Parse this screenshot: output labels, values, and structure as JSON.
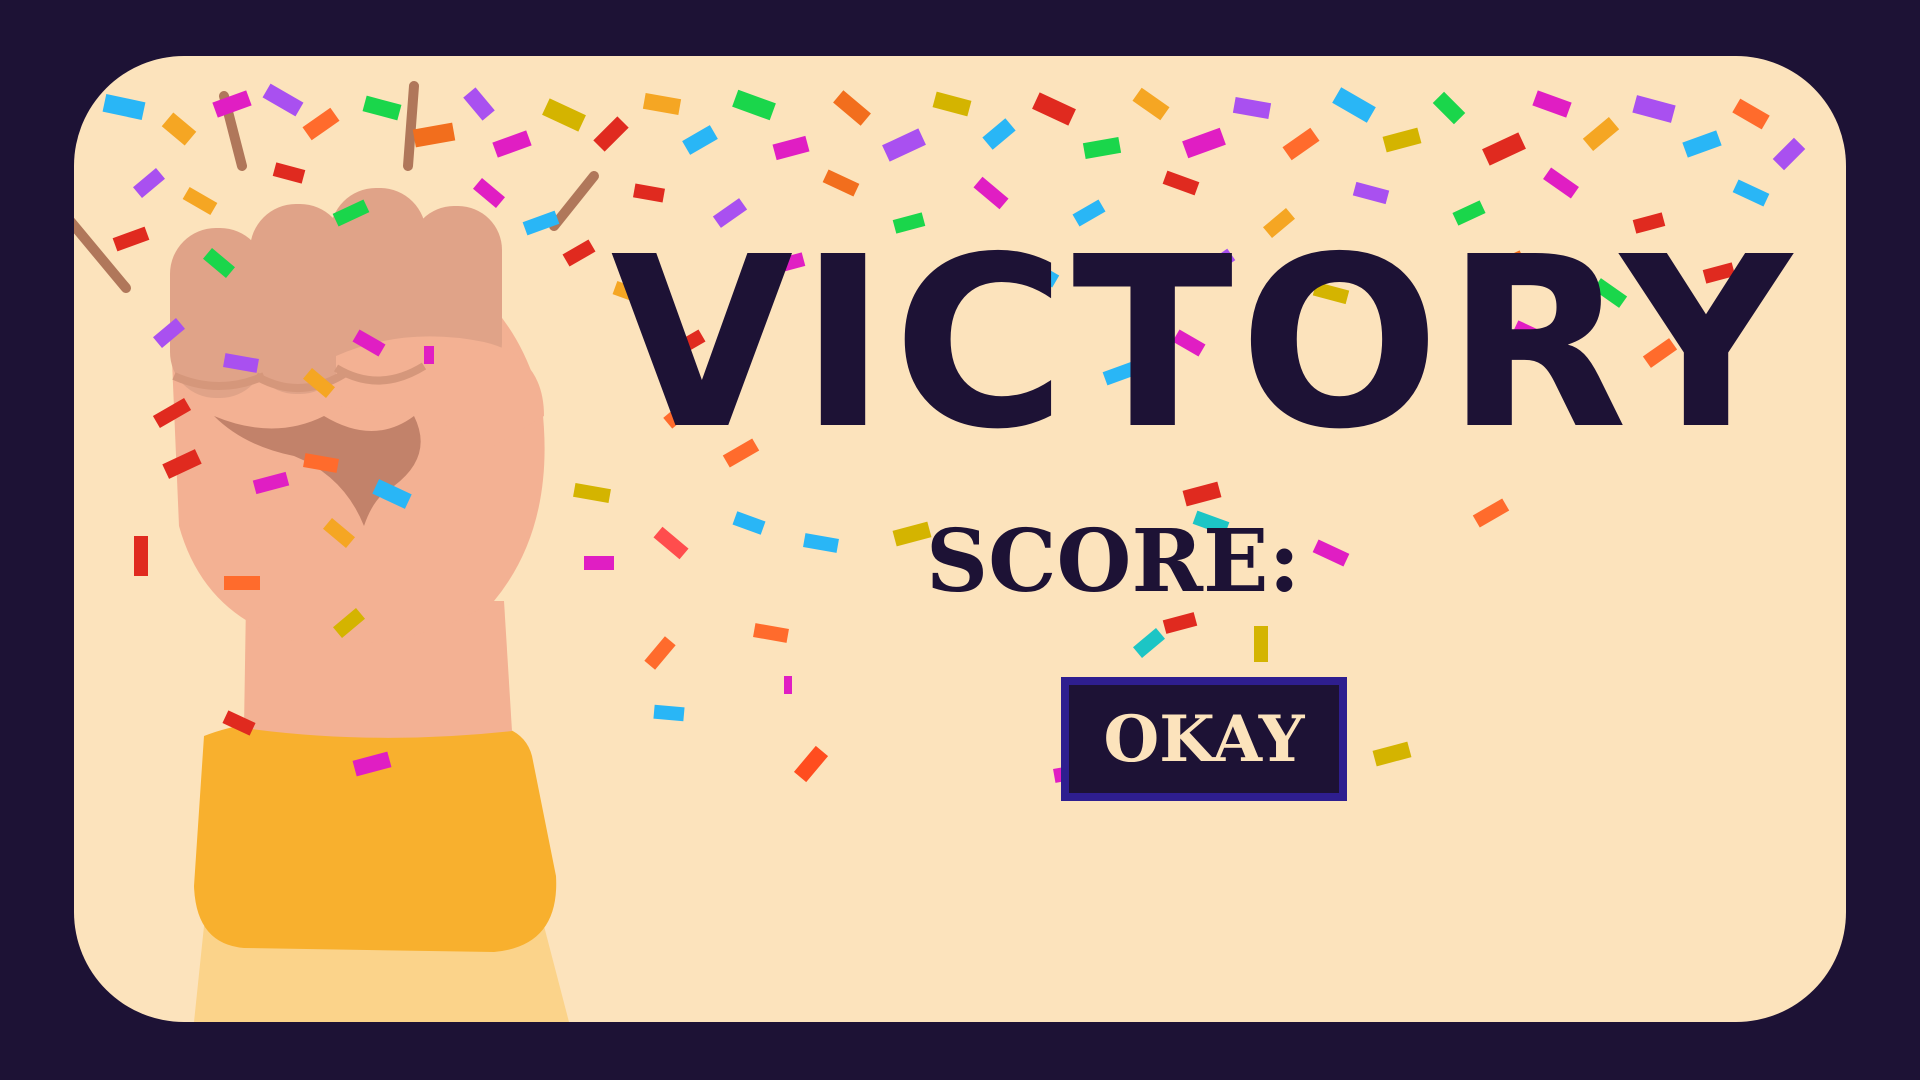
{
  "screen": {
    "title": "VICTORY",
    "score_label": "SCORE:",
    "score_value": "",
    "okay_label": "OKAY"
  },
  "colors": {
    "background": "#1d1235",
    "card": "#fce3bc",
    "text_dark": "#1d1235",
    "button_border": "#2e1e8f",
    "button_text": "#fce3bc",
    "skin": "#f3b193",
    "sleeve": "#f8b02e"
  },
  "icons": {
    "hero": "raised-fist-icon",
    "decoration": "confetti-icon"
  }
}
